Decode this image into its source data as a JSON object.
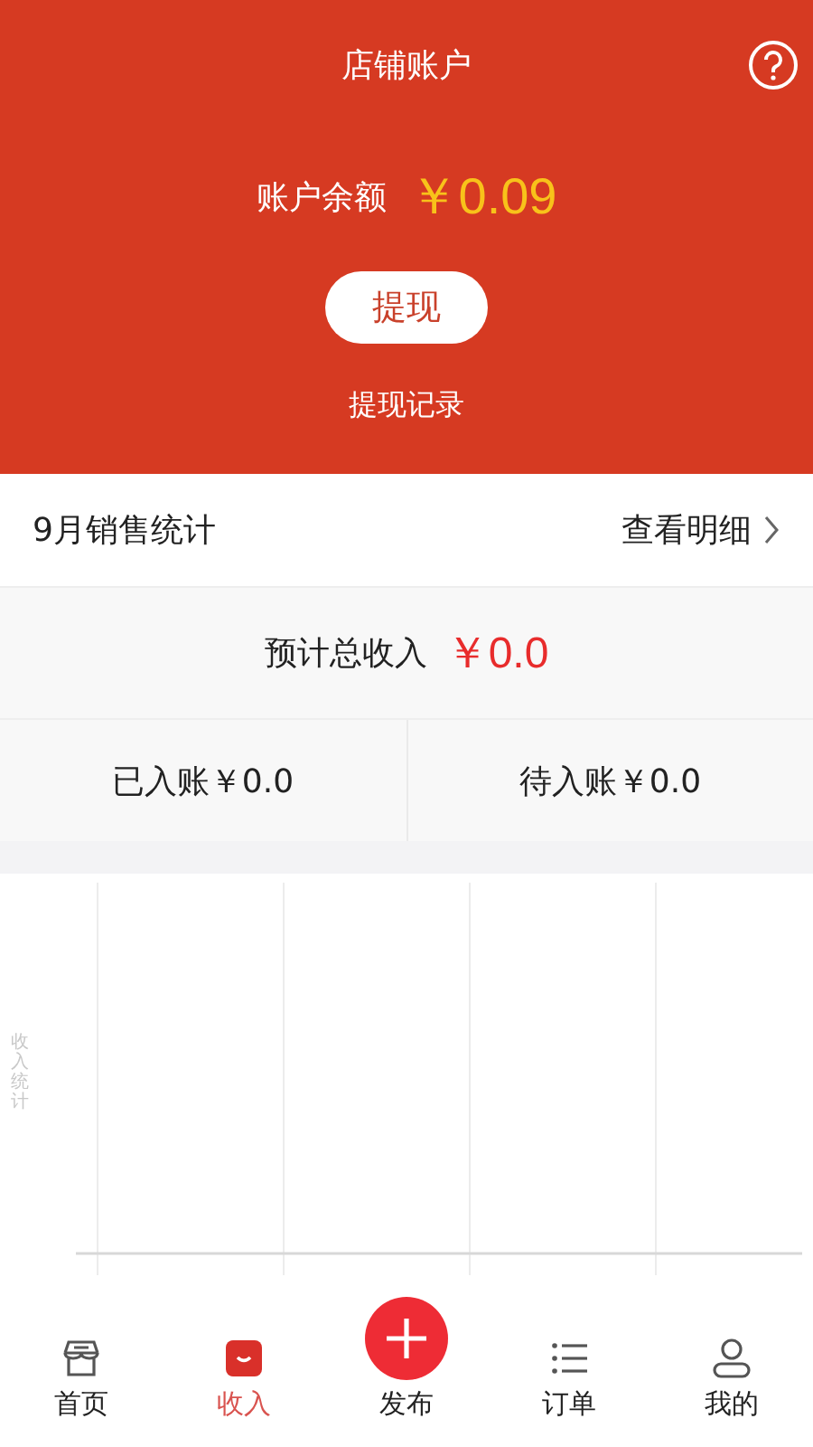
{
  "header": {
    "title": "店铺账户",
    "balance_label": "账户余额",
    "balance": "￥0.09",
    "withdraw_button": "提现",
    "withdraw_records": "提现记录"
  },
  "stats": {
    "title": "9月销售统计",
    "detail_link": "查看明细",
    "total_label": "预计总收入",
    "total": "￥0.0",
    "settled": "已入账￥0.0",
    "pending": "待入账￥0.0"
  },
  "chart": {
    "ylabel": "收入统计"
  },
  "nav": [
    {
      "label": "首页",
      "kind": "home",
      "selected": false
    },
    {
      "label": "收入",
      "kind": "income",
      "selected": true
    },
    {
      "label": "发布",
      "kind": "publish",
      "selected": false
    },
    {
      "label": "订单",
      "kind": "orders",
      "selected": false
    },
    {
      "label": "我的",
      "kind": "me",
      "selected": false
    }
  ]
}
